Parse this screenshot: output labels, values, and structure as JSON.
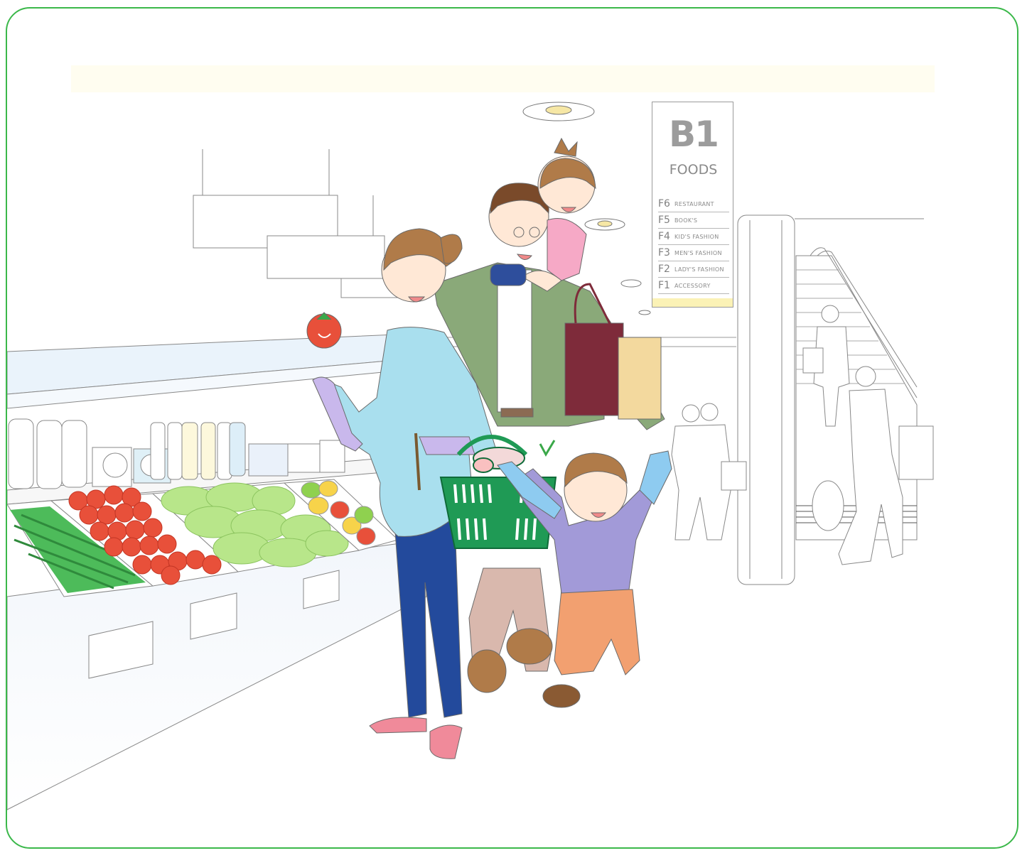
{
  "directory": {
    "level": "B1",
    "department": "FOODS",
    "floors": [
      {
        "floor": "F6",
        "name": "RESTAURANT"
      },
      {
        "floor": "F5",
        "name": "BOOK'S"
      },
      {
        "floor": "F4",
        "name": "KID'S FASHION"
      },
      {
        "floor": "F3",
        "name": "MEN'S FASHION"
      },
      {
        "floor": "F2",
        "name": "LADY'S FASHION"
      },
      {
        "floor": "F1",
        "name": "ACCESSORY"
      }
    ]
  },
  "colors": {
    "frame": "#3bb84a",
    "basket": "#1f9a55",
    "tomato": "#e8503a",
    "cucumber": "#4dbb5a",
    "lettuce": "#b8e68a",
    "mother_top": "#a9dfee",
    "mother_jeans": "#234a9c",
    "father_jacket": "#8aa979",
    "boy_shirt": "#a29ad8",
    "boy_pants": "#f2a070",
    "girl_dress": "#f6a9c6",
    "bag": "#7e2b3a"
  }
}
